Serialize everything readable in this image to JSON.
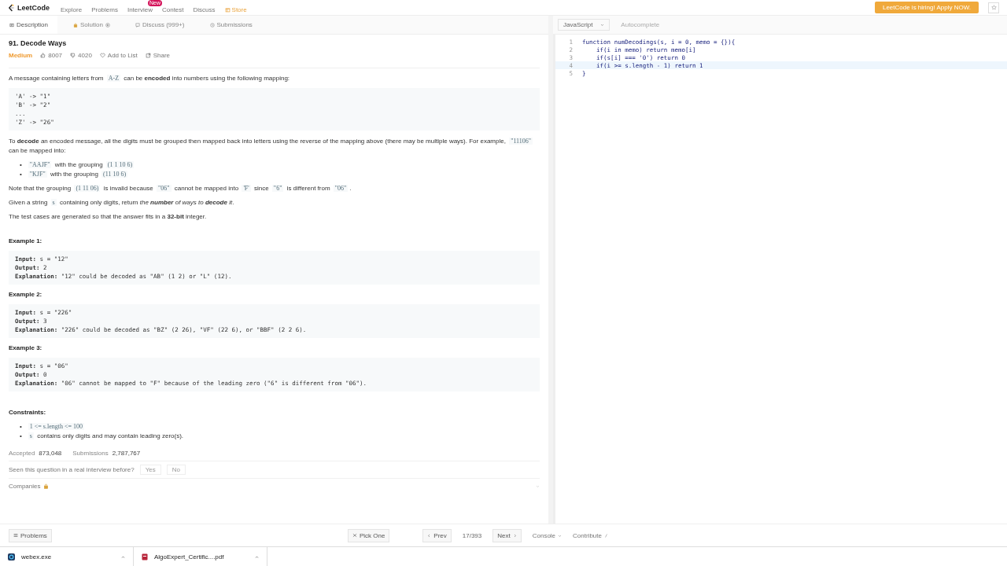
{
  "nav": {
    "logo": "LeetCode",
    "items": [
      {
        "label": "Explore",
        "kind": "link"
      },
      {
        "label": "Problems",
        "kind": "link"
      },
      {
        "label": "Interview",
        "kind": "link",
        "badge": "New"
      },
      {
        "label": "Contest",
        "kind": "link"
      },
      {
        "label": "Discuss",
        "kind": "link"
      },
      {
        "label": "Store",
        "kind": "store"
      }
    ],
    "banner": "LeetCode is hiring! Apply NOW."
  },
  "tabs": [
    {
      "label": "Description",
      "selected": true
    },
    {
      "label": "Solution",
      "selected": false
    },
    {
      "label": "Discuss (999+)",
      "selected": false
    },
    {
      "label": "Submissions",
      "selected": false
    }
  ],
  "problem": {
    "title": "91. Decode Ways",
    "difficulty": "Medium",
    "likes": "8007",
    "dislikes": "4020",
    "add_to_list": "Add to List",
    "share": "Share",
    "blocks": [
      {
        "kind": "paragraph",
        "segments": [
          {
            "kind": "text",
            "text": "A message containing letters from "
          },
          {
            "kind": "code",
            "text": "A-Z"
          },
          {
            "kind": "text",
            "text": " can be **encoded** into numbers using the following mapping:"
          }
        ]
      },
      {
        "kind": "pre",
        "lines": [
          {
            "value": "'A' -> \"1\""
          },
          {
            "value": "'B' -> \"2\""
          },
          {
            "value": "..."
          },
          {
            "value": "'Z' -> \"26\""
          }
        ]
      },
      {
        "kind": "paragraph",
        "segments": [
          {
            "kind": "text",
            "text": "To **decode** an encoded message, all the digits must be grouped then mapped back into letters using the reverse of the mapping above (there may be multiple ways). For example, "
          },
          {
            "kind": "code",
            "text": "\"11106\""
          },
          {
            "kind": "text",
            "text": " can be mapped into:"
          }
        ]
      },
      {
        "kind": "bullets",
        "marker": "•",
        "items": [
          [
            {
              "kind": "code",
              "text": "\"AAJF\""
            },
            {
              "kind": "text",
              "text": " with the grouping "
            },
            {
              "kind": "code",
              "text": "(1 1 10 6)"
            }
          ],
          [
            {
              "kind": "code",
              "text": "\"KJF\""
            },
            {
              "kind": "text",
              "text": " with the grouping "
            },
            {
              "kind": "code",
              "text": "(11 10 6)"
            }
          ]
        ]
      },
      {
        "kind": "paragraph",
        "segments": [
          {
            "kind": "text",
            "text": "Note that the grouping "
          },
          {
            "kind": "code",
            "text": "(1 11 06)"
          },
          {
            "kind": "text",
            "text": " is invalid because "
          },
          {
            "kind": "code",
            "text": "\"06\""
          },
          {
            "kind": "text",
            "text": " cannot be mapped into "
          },
          {
            "kind": "code",
            "text": "'F'"
          },
          {
            "kind": "text",
            "text": " since "
          },
          {
            "kind": "code",
            "text": "\"6\""
          },
          {
            "kind": "text",
            "text": " is different from "
          },
          {
            "kind": "code",
            "text": "\"06\""
          },
          {
            "kind": "text",
            "text": "."
          }
        ]
      },
      {
        "kind": "paragraph",
        "segments": [
          {
            "kind": "text",
            "text": "Given a string "
          },
          {
            "kind": "code",
            "text": "s"
          },
          {
            "kind": "text",
            "text": " containing only digits, return "
          },
          {
            "kind": "italic",
            "text": "the **number** of ways to **decode** it"
          },
          {
            "kind": "text",
            "text": "."
          }
        ]
      },
      {
        "kind": "paragraph",
        "segments": [
          {
            "kind": "text",
            "text": "The test cases are generated so that the answer fits in a **32-bit** integer."
          }
        ]
      },
      {
        "kind": "spacer"
      },
      {
        "kind": "heading",
        "text": "Example 1:"
      },
      {
        "kind": "pre",
        "lines": [
          {
            "label": "Input:",
            "value": " s = \"12\""
          },
          {
            "label": "Output:",
            "value": " 2"
          },
          {
            "label": "Explanation:",
            "value": " \"12\" could be decoded as \"AB\" (1 2) or \"L\" (12)."
          }
        ]
      },
      {
        "kind": "heading",
        "text": "Example 2:"
      },
      {
        "kind": "pre",
        "lines": [
          {
            "label": "Input:",
            "value": " s = \"226\""
          },
          {
            "label": "Output:",
            "value": " 3"
          },
          {
            "label": "Explanation:",
            "value": " \"226\" could be decoded as \"BZ\" (2 26), \"VF\" (22 6), or \"BBF\" (2 2 6)."
          }
        ]
      },
      {
        "kind": "heading",
        "text": "Example 3:"
      },
      {
        "kind": "pre",
        "lines": [
          {
            "label": "Input:",
            "value": " s = \"06\""
          },
          {
            "label": "Output:",
            "value": " 0"
          },
          {
            "label": "Explanation:",
            "value": " \"06\" cannot be mapped to \"F\" because of the leading zero (\"6\" is different from \"06\")."
          }
        ]
      },
      {
        "kind": "spacer"
      },
      {
        "kind": "heading",
        "text": "Constraints:"
      },
      {
        "kind": "bullets",
        "marker": "•",
        "items": [
          [
            {
              "kind": "code",
              "text": "1 <= s.length <= 100"
            }
          ],
          [
            {
              "kind": "code",
              "text": "s"
            },
            {
              "kind": "text",
              "text": " contains only digits and may contain leading zero(s)."
            }
          ]
        ]
      }
    ]
  },
  "stats": {
    "accepted_label": "Accepted",
    "accepted": "873,048",
    "submissions_label": "Submissions",
    "submissions": "2,787,767"
  },
  "interview": {
    "question": "Seen this question in a real interview before?",
    "buttons": [
      "Yes",
      "No"
    ]
  },
  "companies": "Companies",
  "editor": {
    "language": "JavaScript",
    "autocomplete": "Autocomplete",
    "lines": [
      {
        "number": "1",
        "code": "function numDecodings(s, i = 0, memo = {}){",
        "active": false
      },
      {
        "number": "2",
        "code": "    if(i in memo) return memo[i]",
        "active": false
      },
      {
        "number": "3",
        "code": "    if(s[i] === '0') return 0",
        "active": false
      },
      {
        "number": "4",
        "code": "    if(i >= s.length - 1) return 1",
        "active": true
      },
      {
        "number": "5",
        "code": "}",
        "active": false
      }
    ]
  },
  "footer": {
    "problems": "Problems",
    "pick_one": "Pick One",
    "prev": "Prev",
    "page": "17/393",
    "next": "Next",
    "console": "Console",
    "contribute": "Contribute"
  },
  "taskbar": [
    {
      "name": "webex.exe",
      "kind": "exe"
    },
    {
      "name": "AlgoExpert_Certific....pdf",
      "kind": "pdf"
    }
  ]
}
